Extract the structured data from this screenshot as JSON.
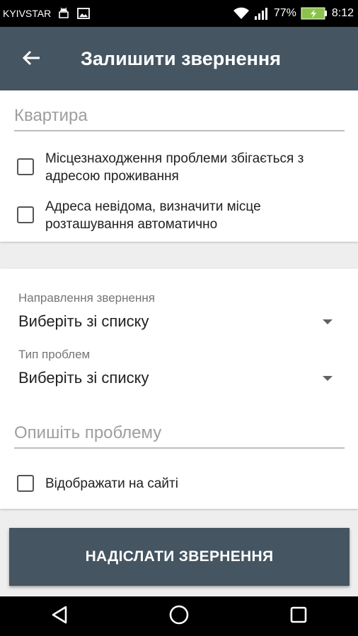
{
  "status_bar": {
    "carrier": "KYIVSTAR",
    "battery_percent": "77%",
    "time": "8:12",
    "icons": [
      "android-icon",
      "image-icon",
      "wifi-icon",
      "signal-icon",
      "battery-charging-icon"
    ]
  },
  "toolbar": {
    "title": "Залишити звернення",
    "back_icon": "arrow-left-icon"
  },
  "address": {
    "apartment_placeholder": "Квартира",
    "checkbox_same_address": {
      "label": "Місцезнаходження проблеми збігається з адресою проживання",
      "checked": false
    },
    "checkbox_unknown_address": {
      "label": "Адреса невідома, визначити місце розташування автоматично",
      "checked": false
    }
  },
  "details": {
    "direction_label": "Направлення звернення",
    "direction_value": "Виберіть зі списку",
    "problem_type_label": "Тип проблем",
    "problem_type_value": "Виберіть зі списку",
    "description_placeholder": "Опишіть проблему",
    "checkbox_show_on_site": {
      "label": "Відображати на сайті",
      "checked": false
    }
  },
  "submit_label": "НАДІСЛАТИ ЗВЕРНЕННЯ",
  "nav_bar": {
    "icons": [
      "back-triangle-icon",
      "home-circle-icon",
      "recents-square-icon"
    ]
  },
  "colors": {
    "primary": "#455561",
    "background": "#eeeeee",
    "card": "#ffffff"
  }
}
